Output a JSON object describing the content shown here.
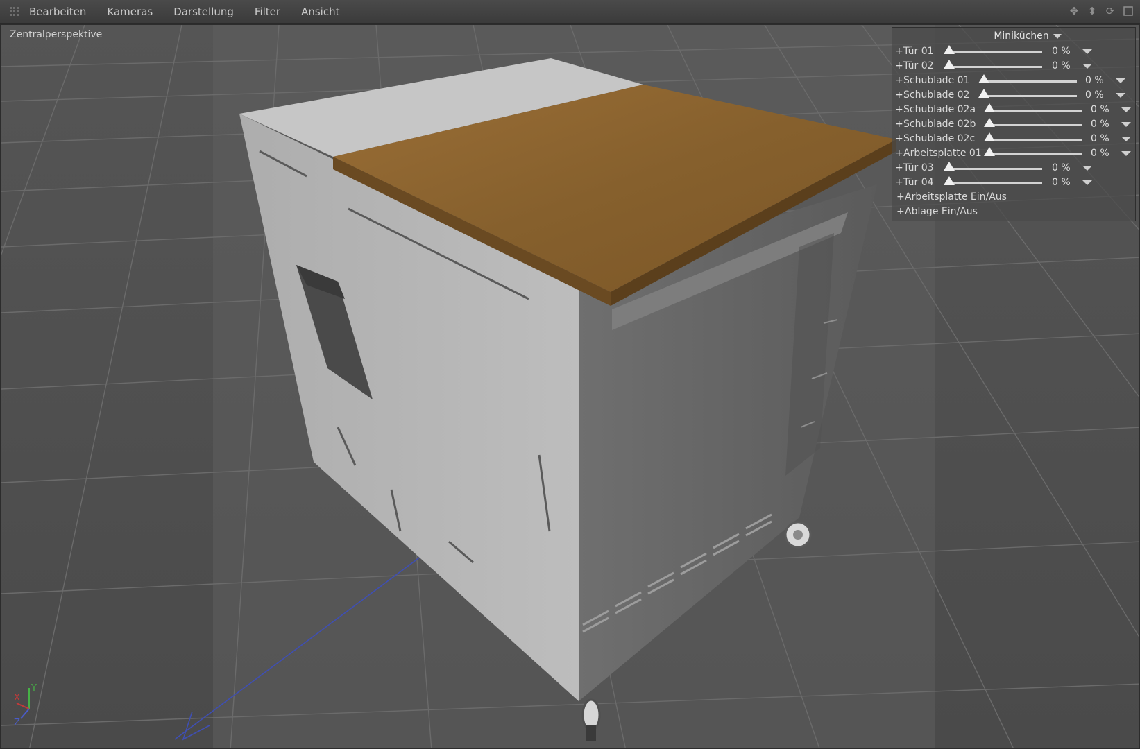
{
  "menubar": {
    "items": [
      "Bearbeiten",
      "Kameras",
      "Darstellung",
      "Filter",
      "Ansicht"
    ]
  },
  "nav_icons": [
    "move-view-icon",
    "zoom-view-icon",
    "rotate-view-icon",
    "maximize-view-icon"
  ],
  "viewport": {
    "label": "Zentralperspektive"
  },
  "panel": {
    "title": "Miniküchen",
    "sliders": [
      {
        "label": "Tür 01",
        "value": "0 %"
      },
      {
        "label": "Tür 02",
        "value": "0 %"
      },
      {
        "label": "Schublade 01",
        "value": "0 %"
      },
      {
        "label": "Schublade 02",
        "value": "0 %"
      },
      {
        "label": "Schublade 02a",
        "value": "0 %"
      },
      {
        "label": "Schublade 02b",
        "value": "0 %"
      },
      {
        "label": "Schublade 02c",
        "value": "0 %"
      },
      {
        "label": "Arbeitsplatte 01",
        "value": "0 %"
      },
      {
        "label": "Tür 03",
        "value": "0 %"
      },
      {
        "label": "Tür 04",
        "value": "0 %"
      }
    ],
    "buttons": [
      "Arbeitsplatte Ein/Aus",
      "Ablage Ein/Aus"
    ]
  },
  "gizmo": {
    "y": "Y",
    "x": "X",
    "z": "Z"
  },
  "colors": {
    "worktop": "#8a6431",
    "cabinet": "#b7b7b7",
    "grid_line": "#6e6e6e",
    "axis_x": "#c23a3a",
    "axis_y": "#46b246",
    "axis_z": "#4a5cc9"
  }
}
